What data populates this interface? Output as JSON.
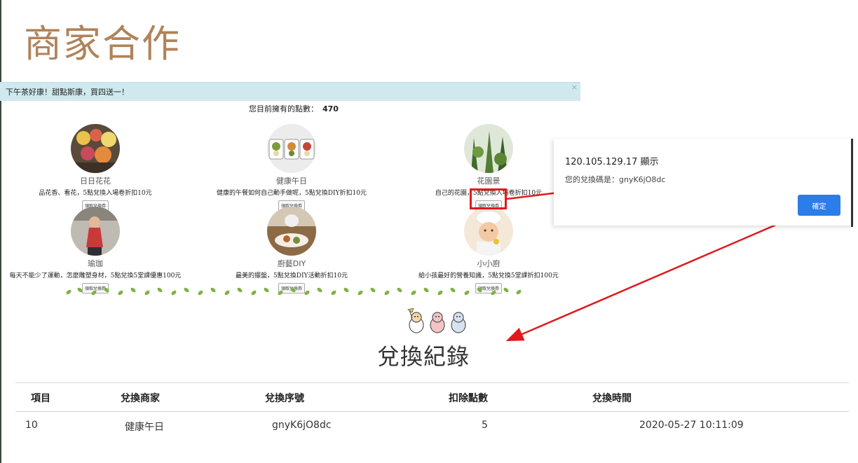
{
  "slide": {
    "title": "商家合作"
  },
  "alert": {
    "text": "下午茶好康！甜點斯康，買四送一！",
    "close": "×"
  },
  "points": {
    "label": "您目前擁有的點數：",
    "value": "470"
  },
  "merchants": [
    {
      "name": "日日花花",
      "desc": "品花香、看花，5點兌換入場卷折扣10元",
      "button": "領取兌換券"
    },
    {
      "name": "健康午日",
      "desc": "健康的午餐如何自己動手做呢，5點兌換DIY折扣10元",
      "button": "領取兌換券"
    },
    {
      "name": "花園景",
      "desc": "自己的花園，5點兌換入場卷折扣10元",
      "button": "領取兌換券"
    },
    {
      "name": "瑜珈",
      "desc": "每天不能少了運動，怎麼雕塑身材，5點兌換5堂課優惠100元",
      "button": "領取兌換券"
    },
    {
      "name": "廚藝DIY",
      "desc": "最美的擺盤，5點兌換DIY活動折扣10元",
      "button": "領取兌換券"
    },
    {
      "name": "小小廚",
      "desc": "給小孩最好的營養知識，5點兌換5堂課折扣100元",
      "button": "領取兌換券"
    }
  ],
  "dialog": {
    "title": "120.105.129.17 顯示",
    "message": "您的兌換碼是：gnyK6jO8dc",
    "ok": "確定"
  },
  "records": {
    "title": "兌換紀錄",
    "headers": [
      "項目",
      "兌換商家",
      "兌換序號",
      "扣除點數",
      "兌換時間"
    ],
    "rows": [
      [
        "10",
        "健康午日",
        "gnyK6jO8dc",
        "5",
        "2020-05-27 10:11:09"
      ]
    ]
  },
  "colors": {
    "title": "#b0835a",
    "alert_bg": "#cfe9ef",
    "highlight": "#e0191d",
    "ok_button": "#2b7de9",
    "vine": "#7cb342"
  }
}
